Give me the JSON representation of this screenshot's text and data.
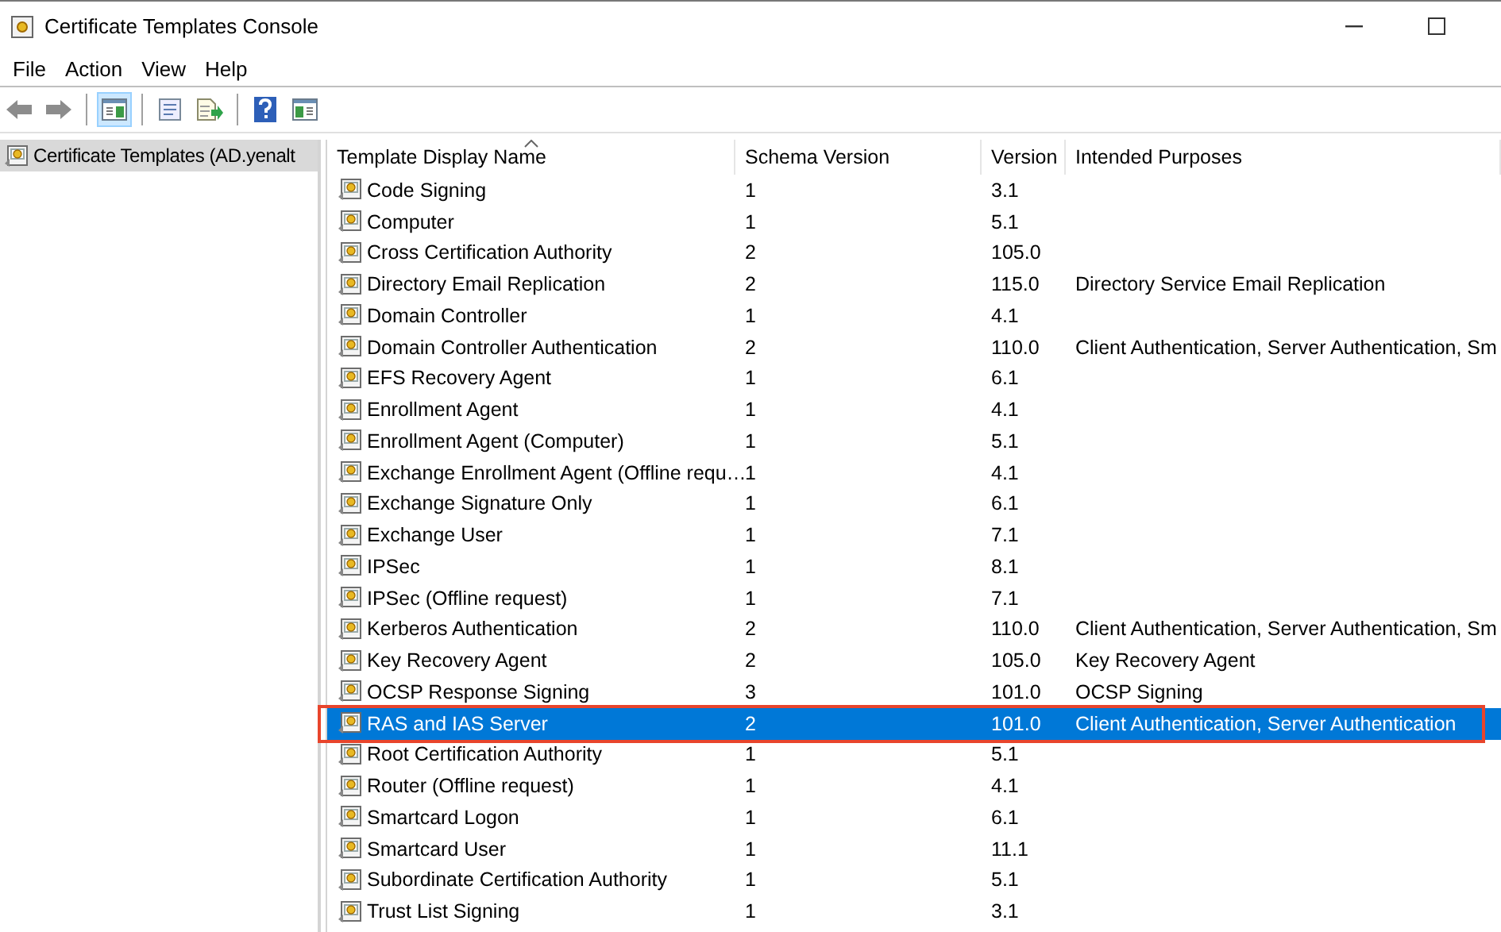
{
  "window": {
    "title": "Certificate Templates Console"
  },
  "menu": [
    "File",
    "Action",
    "View",
    "Help"
  ],
  "toolbar": [
    {
      "kind": "back",
      "pressed": false
    },
    {
      "kind": "forward",
      "pressed": false
    },
    {
      "kind": "sep"
    },
    {
      "kind": "tree",
      "pressed": true
    },
    {
      "kind": "sep"
    },
    {
      "kind": "properties",
      "pressed": false
    },
    {
      "kind": "export",
      "pressed": false
    },
    {
      "kind": "sep"
    },
    {
      "kind": "help",
      "pressed": false
    },
    {
      "kind": "pane",
      "pressed": false
    }
  ],
  "tree": {
    "items": [
      {
        "label": "Certificate Templates (AD.yenalt",
        "selected": true
      }
    ]
  },
  "table": {
    "columns": [
      {
        "label": "Template Display Name",
        "sorted": true
      },
      {
        "label": "Schema Version"
      },
      {
        "label": "Version"
      },
      {
        "label": "Intended Purposes"
      }
    ],
    "rows": [
      {
        "cells": [
          "Code Signing",
          "1",
          "3.1",
          ""
        ],
        "selected": false
      },
      {
        "cells": [
          "Computer",
          "1",
          "5.1",
          ""
        ],
        "selected": false
      },
      {
        "cells": [
          "Cross Certification Authority",
          "2",
          "105.0",
          ""
        ],
        "selected": false
      },
      {
        "cells": [
          "Directory Email Replication",
          "2",
          "115.0",
          "Directory Service Email Replication"
        ],
        "selected": false
      },
      {
        "cells": [
          "Domain Controller",
          "1",
          "4.1",
          ""
        ],
        "selected": false
      },
      {
        "cells": [
          "Domain Controller Authentication",
          "2",
          "110.0",
          "Client Authentication, Server Authentication, Sm"
        ],
        "selected": false
      },
      {
        "cells": [
          "EFS Recovery Agent",
          "1",
          "6.1",
          ""
        ],
        "selected": false
      },
      {
        "cells": [
          "Enrollment Agent",
          "1",
          "4.1",
          ""
        ],
        "selected": false
      },
      {
        "cells": [
          "Enrollment Agent (Computer)",
          "1",
          "5.1",
          ""
        ],
        "selected": false
      },
      {
        "cells": [
          "Exchange Enrollment Agent (Offline requ…",
          "1",
          "4.1",
          ""
        ],
        "selected": false
      },
      {
        "cells": [
          "Exchange Signature Only",
          "1",
          "6.1",
          ""
        ],
        "selected": false
      },
      {
        "cells": [
          "Exchange User",
          "1",
          "7.1",
          ""
        ],
        "selected": false
      },
      {
        "cells": [
          "IPSec",
          "1",
          "8.1",
          ""
        ],
        "selected": false
      },
      {
        "cells": [
          "IPSec (Offline request)",
          "1",
          "7.1",
          ""
        ],
        "selected": false
      },
      {
        "cells": [
          "Kerberos Authentication",
          "2",
          "110.0",
          "Client Authentication, Server Authentication, Sm"
        ],
        "selected": false
      },
      {
        "cells": [
          "Key Recovery Agent",
          "2",
          "105.0",
          "Key Recovery Agent"
        ],
        "selected": false
      },
      {
        "cells": [
          "OCSP Response Signing",
          "3",
          "101.0",
          "OCSP Signing"
        ],
        "selected": false
      },
      {
        "cells": [
          "RAS and IAS Server",
          "2",
          "101.0",
          "Client Authentication, Server Authentication"
        ],
        "selected": true,
        "highlighted": true
      },
      {
        "cells": [
          "Root Certification Authority",
          "1",
          "5.1",
          ""
        ],
        "selected": false
      },
      {
        "cells": [
          "Router (Offline request)",
          "1",
          "4.1",
          ""
        ],
        "selected": false
      },
      {
        "cells": [
          "Smartcard Logon",
          "1",
          "6.1",
          ""
        ],
        "selected": false
      },
      {
        "cells": [
          "Smartcard User",
          "1",
          "11.1",
          ""
        ],
        "selected": false
      },
      {
        "cells": [
          "Subordinate Certification Authority",
          "1",
          "5.1",
          ""
        ],
        "selected": false
      },
      {
        "cells": [
          "Trust List Signing",
          "1",
          "3.1",
          ""
        ],
        "selected": false
      }
    ]
  }
}
